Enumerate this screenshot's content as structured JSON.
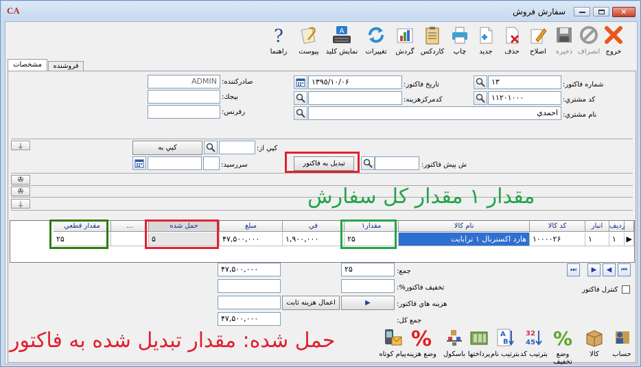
{
  "window": {
    "title": "سفارش فروش",
    "logo": "CA"
  },
  "toolbar": [
    {
      "label": "خروج",
      "icon": "exit-icon"
    },
    {
      "label": "انصراف",
      "icon": "cancel-icon",
      "disabled": true
    },
    {
      "label": "ذخيره",
      "icon": "save-icon",
      "disabled": true
    },
    {
      "label": "اصلاح",
      "icon": "edit-icon"
    },
    {
      "label": "حذف",
      "icon": "delete-icon"
    },
    {
      "label": "جديد",
      "icon": "new-icon"
    },
    {
      "label": "چاپ",
      "icon": "print-icon"
    },
    {
      "label": "کاردکس",
      "icon": "kardex-icon"
    },
    {
      "label": "گردش",
      "icon": "chart-icon"
    },
    {
      "label": "تغييرات",
      "icon": "refresh-icon"
    },
    {
      "label": "نمايش کليد",
      "icon": "keyboard-icon"
    },
    {
      "label": "پيوست",
      "icon": "attach-icon"
    },
    {
      "label": "راهنما",
      "icon": "help-icon"
    }
  ],
  "tabs": {
    "details": "مشخصات",
    "seller": "فروشنده"
  },
  "form": {
    "invoice_no_label": "شماره فاكتور:",
    "invoice_no": "١٣",
    "customer_code_label": "كد مشتري:",
    "customer_code": "١١٢٠١٠٠٠",
    "customer_name_label": "نام مشتري:",
    "customer_name": "احمدي",
    "date_label": "تاريخ فاكتور:",
    "date": "١٣٩٥/١٠/٠۶",
    "cost_center_label": "كدمركزهزينه:",
    "issuer_label": "صادركننده:",
    "issuer": "ADMIN",
    "budget_label": "بيجك:",
    "reference_label": "رفرنس:",
    "copy_from_label": "كپي از:",
    "copy_button": "كپي به",
    "due_label": "سررسيد:",
    "proforma_label": "ش پيش فاكتور:",
    "convert_button": "تبديل به فاكتور"
  },
  "annotations": {
    "top": "مقدار ۱ مقدار کل سفارش",
    "bottom": "حمل شده: مقدار تبدیل شده به فاکتور",
    "top_color": "#22a44a",
    "bottom_color": "#e02030"
  },
  "grid": {
    "headers": {
      "row": "رديف",
      "store": "انبار",
      "code": "كد كالا",
      "name": "نام كالا",
      "qty": "مقدار١",
      "price": "في",
      "amount": "مبلغ",
      "shipped": "حمل شده",
      "more": "...",
      "final_qty": "مقدار قطعي"
    },
    "rows": [
      {
        "row": "١",
        "store": "١",
        "code": "١٠٠٠٠٢۶",
        "name": "هارد اكسترنال ١ ترابايت",
        "qty": "٢۵",
        "price": "١,٩٠٠,٠٠٠",
        "amount": "۴٧,۵٠٠,٠٠٠",
        "shipped": "۵",
        "final_qty": "٢۵"
      }
    ]
  },
  "totals": {
    "sum_label": "جمع:",
    "sum_qty": "٢۵",
    "sum_amount": "۴٧,۵٠٠,٠٠٠",
    "discount_label": "تخفيف فاكتور%:",
    "costs_label": "هزينه هاي فاكتور:",
    "apply_costs_button": "اعمال هزينه ثابت",
    "grand_label": "جمع كل:",
    "grand_total": "۴٧,۵٠٠,٠٠٠",
    "control_label": "كنترل فاكتور"
  },
  "bottombar": [
    {
      "label": "حساب",
      "icon": "account-icon"
    },
    {
      "label": "كالا",
      "icon": "goods-icon"
    },
    {
      "label": "وضع تخفيف",
      "icon": "discount-icon"
    },
    {
      "label": "بترتيب كد",
      "icon": "sort-code-icon"
    },
    {
      "label": "بترتيب نام",
      "icon": "sort-name-icon"
    },
    {
      "label": "پرداختها",
      "icon": "payments-icon"
    },
    {
      "label": "باسكول",
      "icon": "scale-icon"
    },
    {
      "label": "وضع هزينه",
      "icon": "cost-percent-icon"
    },
    {
      "label": "پيام كوتاه",
      "icon": "sms-icon"
    }
  ]
}
